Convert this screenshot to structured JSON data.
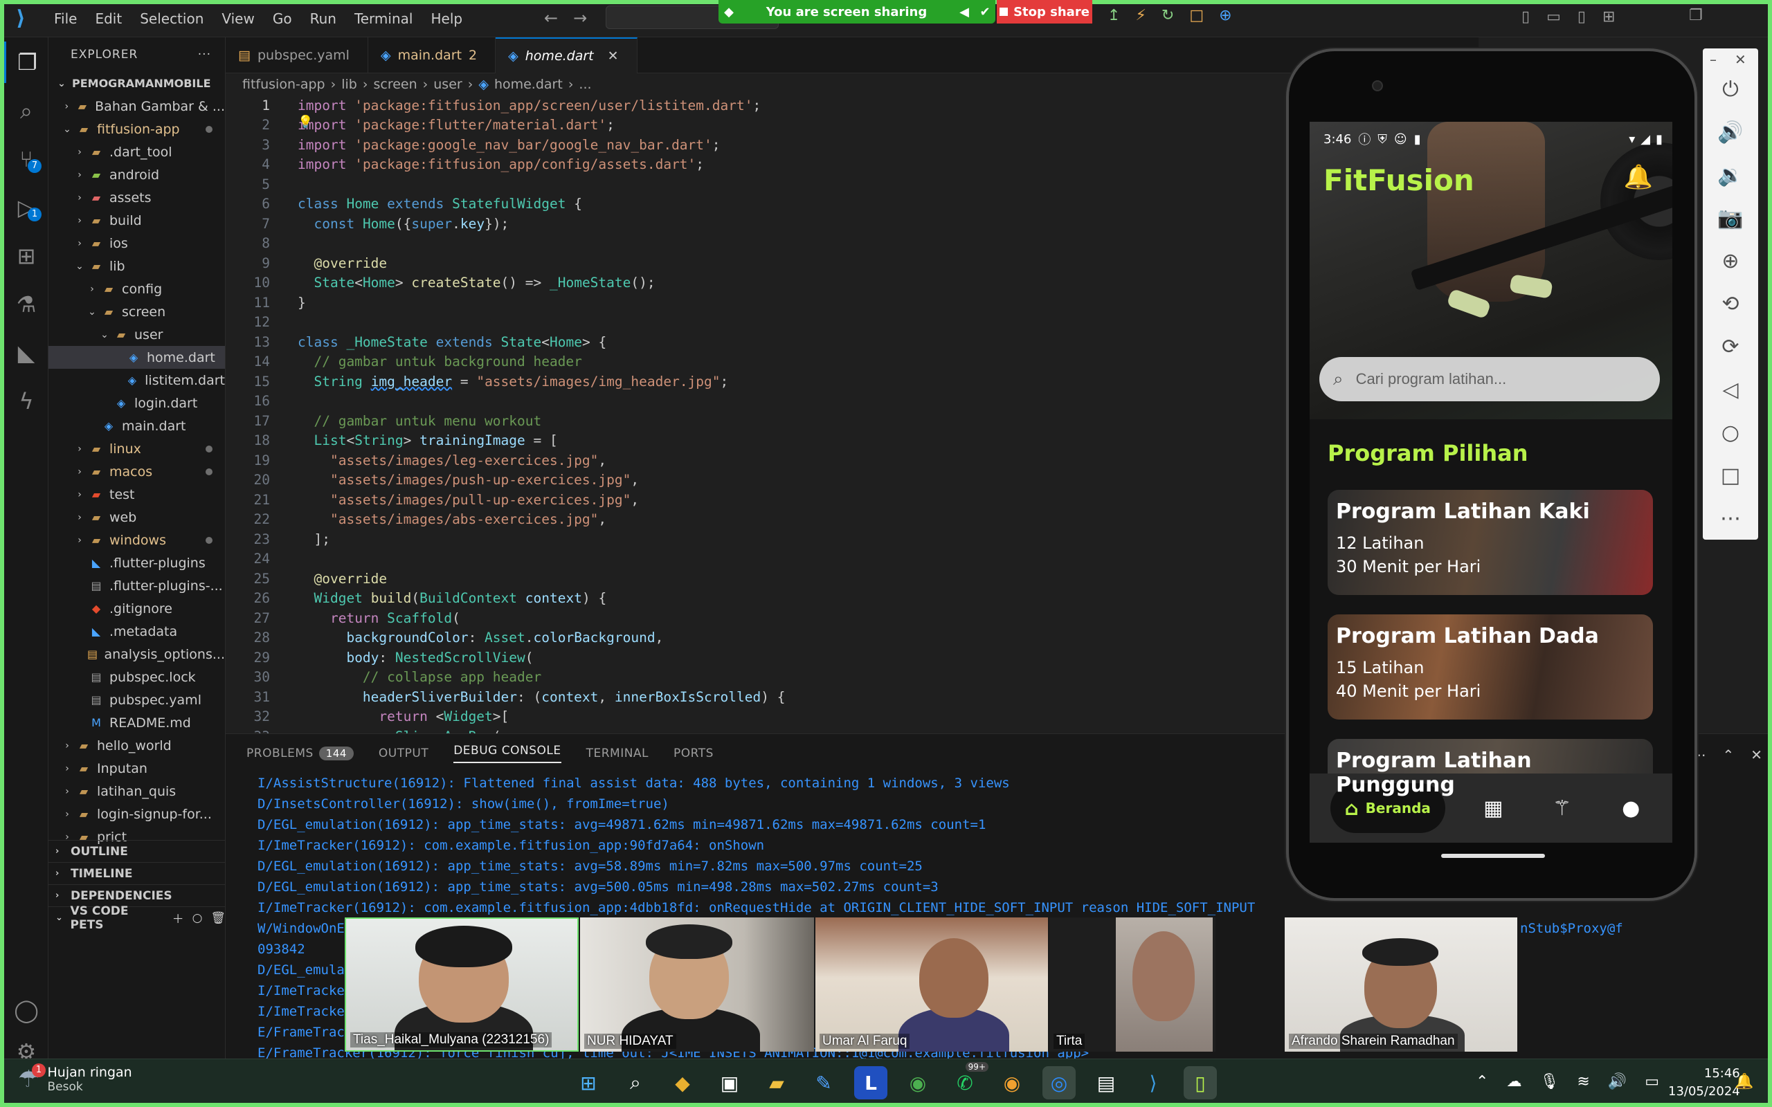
{
  "titlebar": {
    "menu": [
      "File",
      "Edit",
      "Selection",
      "View",
      "Go",
      "Run",
      "Terminal",
      "Help"
    ],
    "share_status": "You are screen sharing",
    "stop_share": "Stop share"
  },
  "activity": {
    "scm_badge": "7",
    "debug_badge": "1"
  },
  "explorer": {
    "title": "EXPLORER",
    "root": "PEMOGRAMANMOBILE",
    "items": [
      {
        "label": "Bahan Gambar & ...",
        "icon": "folder",
        "depth": 1
      },
      {
        "label": "fitfusion-app",
        "icon": "folder-open",
        "depth": 1
      },
      {
        "label": ".dart_tool",
        "icon": "folder",
        "depth": 2
      },
      {
        "label": "android",
        "icon": "folder-android",
        "depth": 2
      },
      {
        "label": "assets",
        "icon": "folder-assets",
        "depth": 2
      },
      {
        "label": "build",
        "icon": "folder",
        "depth": 2
      },
      {
        "label": "ios",
        "icon": "folder",
        "depth": 2
      },
      {
        "label": "lib",
        "icon": "folder-open",
        "depth": 2
      },
      {
        "label": "config",
        "icon": "folder",
        "depth": 3
      },
      {
        "label": "screen",
        "icon": "folder-open",
        "depth": 3
      },
      {
        "label": "user",
        "icon": "folder-open",
        "depth": 4
      },
      {
        "label": "home.dart",
        "icon": "dart",
        "depth": 5
      },
      {
        "label": "listitem.dart",
        "icon": "dart",
        "depth": 5
      },
      {
        "label": "login.dart",
        "icon": "dart",
        "depth": 4
      },
      {
        "label": "main.dart",
        "icon": "dart",
        "depth": 3
      },
      {
        "label": "linux",
        "icon": "folder",
        "depth": 2
      },
      {
        "label": "macos",
        "icon": "folder",
        "depth": 2
      },
      {
        "label": "test",
        "icon": "folder-test",
        "depth": 2
      },
      {
        "label": "web",
        "icon": "folder",
        "depth": 2
      },
      {
        "label": "windows",
        "icon": "folder",
        "depth": 2
      },
      {
        "label": ".flutter-plugins",
        "icon": "flutter",
        "depth": 2
      },
      {
        "label": ".flutter-plugins-...",
        "icon": "file",
        "depth": 2
      },
      {
        "label": ".gitignore",
        "icon": "git",
        "depth": 2
      },
      {
        "label": ".metadata",
        "icon": "flutter",
        "depth": 2
      },
      {
        "label": "analysis_options...",
        "icon": "yaml",
        "depth": 2
      },
      {
        "label": "pubspec.lock",
        "icon": "file",
        "depth": 2
      },
      {
        "label": "pubspec.yaml",
        "icon": "file",
        "depth": 2
      },
      {
        "label": "README.md",
        "icon": "md",
        "depth": 2
      },
      {
        "label": "hello_world",
        "icon": "folder",
        "depth": 1
      },
      {
        "label": "Inputan",
        "icon": "folder",
        "depth": 1
      },
      {
        "label": "latihan_quis",
        "icon": "folder",
        "depth": 1
      },
      {
        "label": "login-signup-for...",
        "icon": "folder",
        "depth": 1
      },
      {
        "label": "prict",
        "icon": "folder",
        "depth": 1
      }
    ],
    "sections": [
      "OUTLINE",
      "TIMELINE",
      "DEPENDENCIES",
      "VS CODE PETS"
    ]
  },
  "tabs": [
    {
      "label": "pubspec.yaml"
    },
    {
      "label": "main.dart",
      "suffix": "2"
    },
    {
      "label": "home.dart"
    }
  ],
  "breadcrumb": [
    "fitfusion-app",
    "lib",
    "screen",
    "user",
    "home.dart",
    "..."
  ],
  "panel": {
    "tabs": [
      "PROBLEMS",
      "OUTPUT",
      "DEBUG CONSOLE",
      "TERMINAL",
      "PORTS"
    ],
    "problems_count": "144",
    "log": [
      "I/AssistStructure(16912): Flattened final assist data: 488 bytes, containing 1 windows, 3 views",
      "D/InsetsController(16912): show(ime(), fromIme=true)",
      "D/EGL_emulation(16912): app_time_stats: avg=49871.62ms min=49871.62ms max=49871.62ms count=1",
      "I/ImeTracker(16912): com.example.fitfusion_app:90fd7a64: onShown",
      "D/EGL_emulation(16912): app_time_stats: avg=58.89ms min=7.82ms max=500.97ms count=25",
      "D/EGL_emulation(16912): app_time_stats: avg=500.05ms min=498.28ms max=502.27ms count=3",
      "I/ImeTracker(16912): com.example.fitfusion_app:4dbb18fd: onRequestHide at ORIGIN_CLIENT_HIDE_SOFT_INPUT reason HIDE_SOFT_INPUT",
      "W/WindowOnE",
      "093842",
      "D/EGL_emula",
      "I/ImeTracke",
      "I/ImeTracke",
      "E/FrameTrac",
      "E/FrameTracker(16912): force finish cuj, time out: J<IME_INSETS_ANIMATION::1@1@com.example.fitfusion_app>"
    ],
    "log_tail_right": "nStub$Proxy@f"
  },
  "phone": {
    "time": "3:46",
    "app_title": "FitFusion",
    "search_placeholder": "Cari program latihan...",
    "section_title": "Program Pilihan",
    "cards": [
      {
        "title": "Program Latihan Kaki",
        "count": "12 Latihan",
        "duration": "30 Menit per Hari"
      },
      {
        "title": "Program Latihan Dada",
        "count": "15 Latihan",
        "duration": "40 Menit per Hari"
      },
      {
        "title": "Program Latihan Punggung",
        "count": "",
        "duration": ""
      }
    ],
    "nav_home": "Beranda"
  },
  "participants": [
    {
      "name": "Tias_Haikal_Mulyana (22312156)"
    },
    {
      "name": "NUR HIDAYAT"
    },
    {
      "name": "Umar Al Faruq"
    },
    {
      "name": "Tirta"
    },
    {
      "name": "Afrando Sharein Ramadhan"
    }
  ],
  "taskbar": {
    "weather_title": "Hujan ringan",
    "weather_sub": "Besok",
    "weather_badge": "1",
    "whatsapp_badge": "99+",
    "time": "15:46",
    "date": "13/05/2024"
  },
  "colors": {
    "accent": "#b8f24a",
    "share_green": "#27a227",
    "stop_red": "#e43b3b",
    "vscode_blue": "#0078d4"
  }
}
